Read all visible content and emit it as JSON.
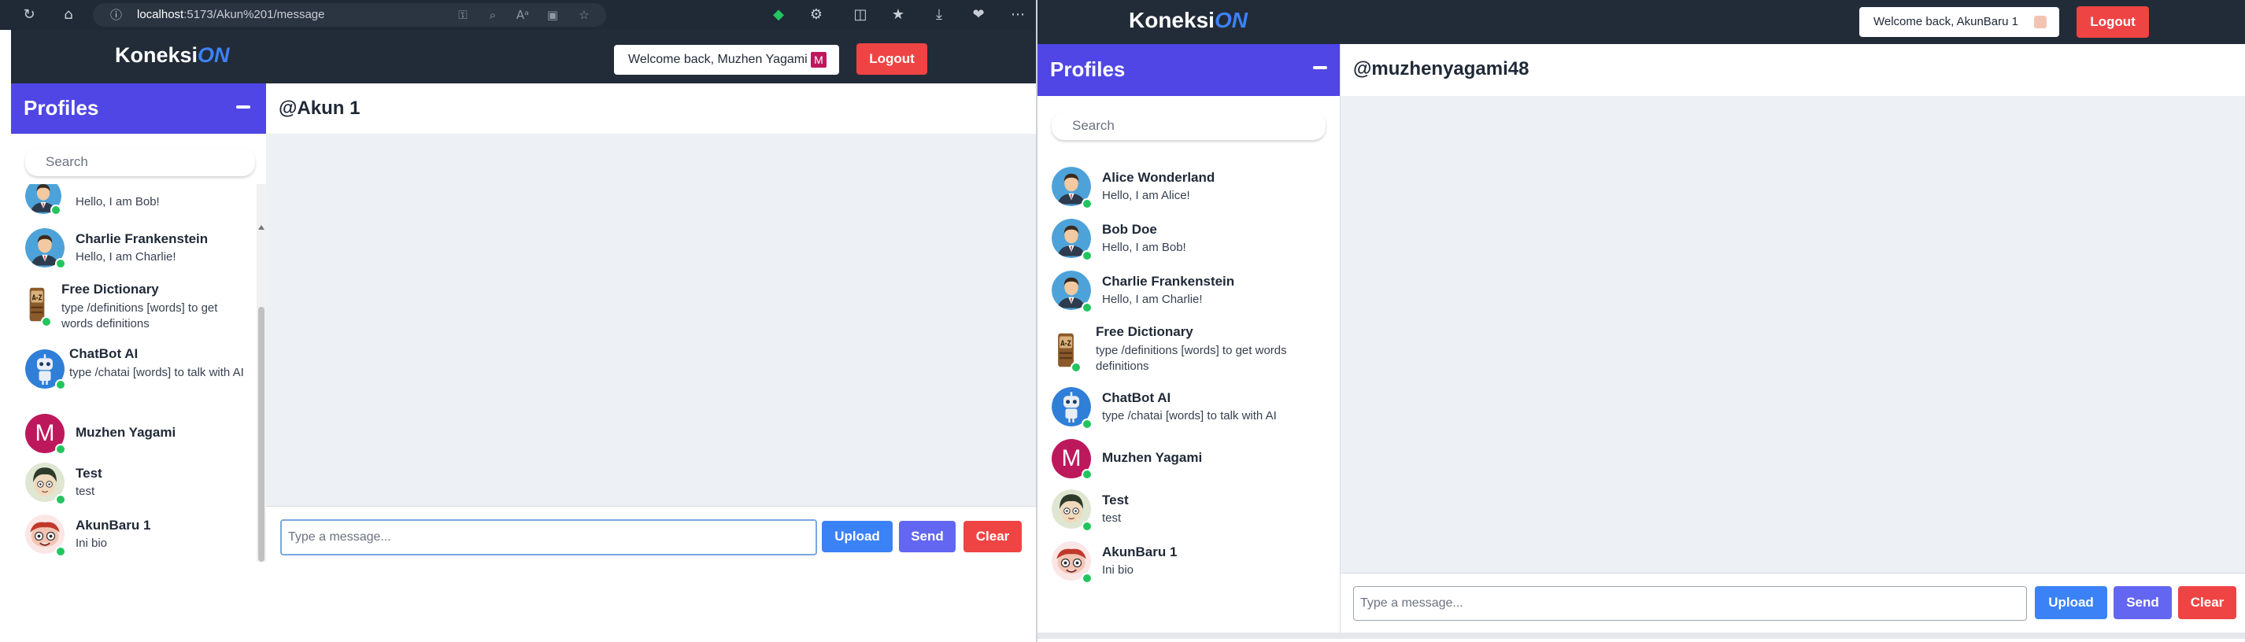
{
  "browser": {
    "address_host": "localhost",
    "address_rest": ":5173/Akun%201/message"
  },
  "left_app": {
    "logo_main": "Koneksi",
    "logo_accent": "ON",
    "welcome_text": "Welcome back, Muzhen Yagami",
    "welcome_avatar_letter": "M",
    "logout_label": "Logout",
    "profiles_title": "Profiles",
    "search_placeholder": "Search",
    "chat_title": "@Akun 1",
    "message_placeholder": "Type a message...",
    "upload_label": "Upload",
    "send_label": "Send",
    "clear_label": "Clear",
    "partial_item": {
      "bio": "Hello, I am Bob!"
    },
    "profiles": [
      {
        "name": "Charlie Frankenstein",
        "bio": "Hello, I am Charlie!"
      },
      {
        "name": "Free Dictionary",
        "bio": "type /definitions [words] to get words definitions"
      },
      {
        "name": "ChatBot AI",
        "bio": "type /chatai [words] to talk with AI"
      },
      {
        "name": "Muzhen Yagami",
        "bio": "",
        "letter": "M"
      },
      {
        "name": "Test",
        "bio": "test"
      },
      {
        "name": "AkunBaru 1",
        "bio": "Ini bio"
      }
    ]
  },
  "right_app": {
    "logo_main": "Koneksi",
    "logo_accent": "ON",
    "welcome_text": "Welcome back, AkunBaru 1",
    "logout_label": "Logout",
    "profiles_title": "Profiles",
    "search_placeholder": "Search",
    "chat_title": "@muzhenyagami48",
    "message_placeholder": "Type a message...",
    "upload_label": "Upload",
    "send_label": "Send",
    "clear_label": "Clear",
    "profiles": [
      {
        "name": "Alice Wonderland",
        "bio": "Hello, I am Alice!"
      },
      {
        "name": "Bob Doe",
        "bio": "Hello, I am Bob!"
      },
      {
        "name": "Charlie Frankenstein",
        "bio": "Hello, I am Charlie!"
      },
      {
        "name": "Free Dictionary",
        "bio": "type /definitions [words] to get words definitions"
      },
      {
        "name": "ChatBot AI",
        "bio": "type /chatai [words] to talk with AI"
      },
      {
        "name": "Muzhen Yagami",
        "bio": "",
        "letter": "M"
      },
      {
        "name": "Test",
        "bio": "test"
      },
      {
        "name": "AkunBaru 1",
        "bio": "Ini bio"
      }
    ]
  },
  "colors": {
    "header_bg": "#222b38",
    "profiles_header": "#4f46e5",
    "logout": "#ef4444",
    "upload": "#3b82f6",
    "send": "#6366f1",
    "online": "#22c55e",
    "chat_bg": "#edf0f4"
  }
}
